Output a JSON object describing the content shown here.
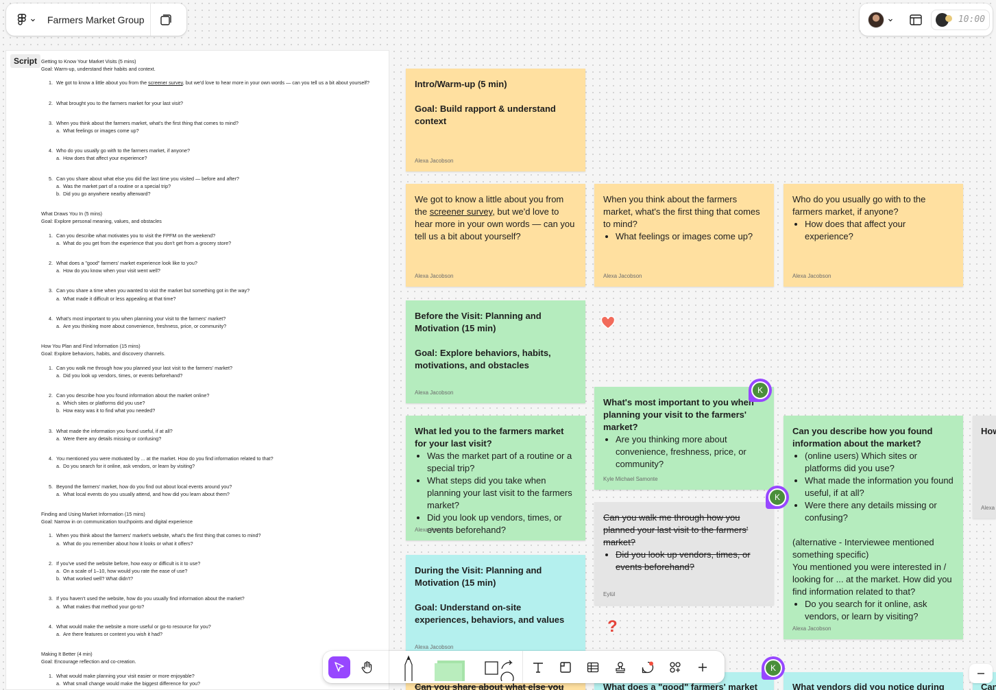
{
  "app": {
    "file_name": "Farmers Market Group",
    "timer": "10:00",
    "colors": {
      "accent": "#9747ff",
      "sticky_yellow": "#ffe0a0",
      "sticky_green": "#b5ecbe",
      "sticky_cyan": "#b4f0ee",
      "sticky_gray": "#e5e5e5",
      "avatar_k": "#4a8f3a"
    }
  },
  "script": {
    "tag": "Script",
    "sections": [
      {
        "title": "Getting to Know Your Market Visits (5 mins)",
        "goal": "Goal: Warm-up, understand their habits and context.",
        "questions": [
          {
            "n": "1.",
            "pre": "We got to know a little about you from the ",
            "link": "screener survey",
            "post": ", but we'd love to hear more in your own words — can you tell us a bit about yourself?"
          },
          {
            "n": "2.",
            "text": "What brought you to the farmers market for your last visit?"
          },
          {
            "n": "3.",
            "text": "When you think about the farmers market, what's the first thing that comes to mind?",
            "subs": [
              "What feelings or images come up?"
            ]
          },
          {
            "n": "4.",
            "text": "Who do you usually go with to the farmers market, if anyone?",
            "subs": [
              "How does that affect your experience?"
            ]
          },
          {
            "n": "5.",
            "text": "Can you share about what else you did the last time you visited — before and after?",
            "subs": [
              "Was the market part of a routine or a special trip?",
              "Did you go anywhere nearby afterward?"
            ]
          }
        ]
      },
      {
        "title": "What Draws You In (5 mins)",
        "goal": "Goal: Explore personal meaning, values, and obstacles",
        "questions": [
          {
            "n": "1.",
            "text": "Can you describe what motivates you to visit the FPFM on the weekend?",
            "subs": [
              "What do you get from the experience that you don't get from a grocery store?"
            ]
          },
          {
            "n": "2.",
            "text": "What does a \"good\" farmers' market experience look like to you?",
            "subs": [
              "How do you know when your visit went well?"
            ]
          },
          {
            "n": "3.",
            "text": "Can you share a time when you wanted to visit the market but something got in the way?",
            "subs": [
              "What made it difficult or less appealing at that time?"
            ]
          },
          {
            "n": "4.",
            "text": "What's most important to you when planning your visit to the farmers' market?",
            "subs": [
              "Are you thinking more about convenience, freshness, price, or community?"
            ]
          }
        ]
      },
      {
        "title": "How You Plan and Find Information (15 mins)",
        "goal": "Goal: Explore behaviors, habits, and discovery channels.",
        "questions": [
          {
            "n": "1.",
            "text": "Can you walk me through how you planned your last visit to the farmers' market?",
            "subs": [
              "Did you look up vendors, times, or events beforehand?"
            ]
          },
          {
            "n": "2.",
            "text": "Can you describe how you found information about the market online?",
            "subs": [
              "Which sites or platforms did you use?",
              "How easy was it to find what you needed?"
            ]
          },
          {
            "n": "3.",
            "text": "What made the information you found useful, if at all?",
            "subs": [
              "Were there any details missing or confusing?"
            ]
          },
          {
            "n": "4.",
            "text": "You mentioned you were motivated by ... at the market. How do you find information related to that?",
            "subs": [
              "Do you search for it online, ask vendors, or learn by visiting?"
            ]
          },
          {
            "n": "5.",
            "text": "Beyond the farmers' market, how do you find out about local events around you?",
            "subs": [
              "What local events do you usually attend, and how did you learn about them?"
            ]
          }
        ]
      },
      {
        "title": "Finding and Using Market Information (15 mins)",
        "goal": "Goal: Narrow in on communication touchpoints and digital experience",
        "questions": [
          {
            "n": "1.",
            "text": "When you think about the farmers' market's website, what's the first thing that comes to mind?",
            "subs": [
              "What do you remember about how it looks or what it offers?"
            ]
          },
          {
            "n": "2.",
            "text": "If you've used the website before, how easy or difficult is it to use?",
            "subs": [
              "On a scale of 1–10, how would you rate the ease of use?",
              "What worked well? What didn't?"
            ]
          },
          {
            "n": "3.",
            "text": "If you haven't used the website, how do you usually find information about the market?",
            "subs": [
              "What makes that method your go-to?"
            ]
          },
          {
            "n": "4.",
            "text": "What would make the website a more useful or go-to resource for you?",
            "subs": [
              "Are there features or content you wish it had?"
            ]
          }
        ]
      },
      {
        "title": "Making It Better (4 min)",
        "goal": "Goal: Encourage reflection and co-creation.",
        "questions": [
          {
            "n": "1.",
            "text": "What would make planning your visit easier or more enjoyable?",
            "subs": [
              "What small change would make the biggest difference for you?"
            ]
          }
        ]
      }
    ],
    "sub_markers": [
      "a.",
      "b."
    ]
  },
  "stickies": {
    "intro": {
      "line1": "Intro/Warm-up (5 min)",
      "line2": "Goal: Build rapport & understand context",
      "author": "Alexa Jacobson"
    },
    "about": {
      "pre": "We got to know a little about you from the ",
      "link": "screener survey",
      "post": ", but we'd love to hear more in your own words — can you tell us a bit about yourself?",
      "author": "Alexa Jacobson"
    },
    "first_thing": {
      "text": "When you think about the farmers market, what's the first thing that comes to mind?",
      "bullet": "What feelings or images come up?",
      "author": "Alexa Jacobson"
    },
    "who_with": {
      "text": "Who do you usually go with to the farmers market, if anyone?",
      "bullet": "How does that affect your experience?",
      "author": "Alexa Jacobson"
    },
    "before_visit": {
      "line1": "Before the Visit: Planning and Motivation (15 min)",
      "line2": "Goal: Explore behaviors, habits, motivations, and obstacles",
      "author": "Alexa Jacobson"
    },
    "most_important": {
      "text": "What's most important to you when planning your visit to the farmers' market?",
      "bullet": "Are you thinking more about convenience, freshness, price, or community?",
      "author": "Kyle Michael Samonte"
    },
    "what_led": {
      "text": "What led you to the farmers market for your last visit?",
      "bullets": [
        "Was the market part of a routine or a special trip?",
        "What steps did you take when planning your last visit to the farmers market?",
        "Did you look up vendors, times, or events beforehand?"
      ],
      "author": "Alexa Jacobson"
    },
    "walk_me": {
      "text": "Can you walk me through how you planned your last visit to the farmers' market?",
      "bullet": "Did you look up vendors, times, or events beforehand?",
      "author": "Eylül"
    },
    "describe_found": {
      "text": "Can you describe how you found information about the market?",
      "bullets": [
        "(online users) Which sites or platforms did you use?",
        "What made the information you found useful, if at all?",
        "Were there any details missing or confusing?"
      ],
      "alt1": "(alternative - Interviewee mentioned something specific)",
      "alt2": "You mentioned you were interested in / looking for ... at the market. How did you find information related to that?",
      "alt_bullet": "Do you search for it online, ask vendors, or learn by visiting?",
      "author": "Alexa Jacobson"
    },
    "during_visit": {
      "line1": "During the Visit: Planning and Motivation (15 min)",
      "line2": "Goal: Understand on-site experiences, behaviors, and values",
      "author": "Alexa Jacobson"
    },
    "partial_right": {
      "text": "How",
      "author": "Alexa"
    },
    "bottom1": {
      "text": "Can you share about what else you did"
    },
    "bottom2": {
      "text": "What does a \"good\" farmers' market"
    },
    "bottom3": {
      "text": "What vendors did you notice during your"
    },
    "bottom4": {
      "text": "Can"
    }
  },
  "pins": {
    "initial": "K"
  },
  "toolbar": {
    "tools": [
      "move",
      "hand",
      "pen",
      "sticky",
      "shape",
      "text",
      "section",
      "table",
      "stamp",
      "comment",
      "widgets",
      "more"
    ]
  }
}
